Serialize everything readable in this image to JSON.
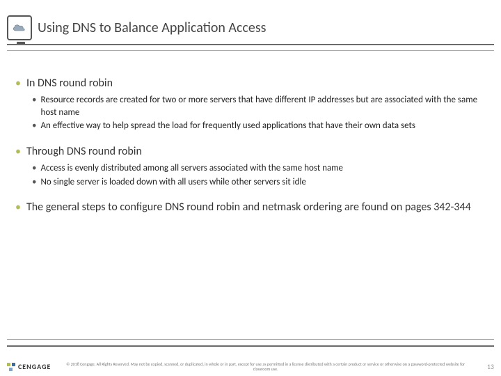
{
  "title": "Using DNS to Balance Application Access",
  "bullets": {
    "g1": {
      "head": "In DNS round robin",
      "sub1": "Resource records are created for two or more servers that have different IP addresses but are associated with the same host name",
      "sub2": "An effective way to help spread the load for frequently used applications that have their own data sets"
    },
    "g2": {
      "head": "Through DNS round robin",
      "sub1": "Access is evenly distributed among all servers associated with the same host name",
      "sub2": "No single server is loaded down with all users while other servers sit idle"
    },
    "g3": {
      "head": "The general steps to configure DNS round robin and netmask ordering are found on pages 342-344"
    }
  },
  "footer": {
    "brand": "CENGAGE",
    "copyright": "© 2018 Cengage. All Rights Reserved. May not be copied, scanned, or duplicated, in whole or in part, except for use as permitted in a license distributed with a certain product or service or otherwise on a password-protected website for classroom use.",
    "page": "13"
  }
}
